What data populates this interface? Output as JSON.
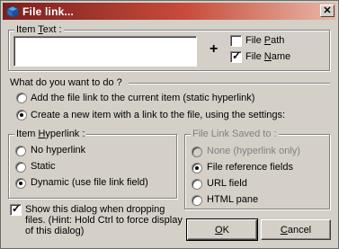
{
  "window": {
    "title": "File link..."
  },
  "item_text": {
    "legend": "Item Text :",
    "value": "",
    "file_path_label": "File Path",
    "file_path_checked": false,
    "file_name_label": "File Name",
    "file_name_checked": true
  },
  "action": {
    "header": "What do you want to do ?",
    "options": [
      {
        "label": "Add the file link to the current item (static hyperlink)",
        "selected": false
      },
      {
        "label": "Create a new item with a link to the file, using the settings:",
        "selected": true
      }
    ]
  },
  "item_hyperlink": {
    "legend": "Item Hyperlink :",
    "options": [
      {
        "label": "No hyperlink",
        "selected": false
      },
      {
        "label": "Static",
        "selected": false
      },
      {
        "label": "Dynamic (use file link field)",
        "selected": true
      }
    ]
  },
  "file_link_saved": {
    "legend": "File Link Saved to :",
    "options": [
      {
        "label": "None (hyperlink only)",
        "selected": false,
        "disabled": true
      },
      {
        "label": "File reference fields",
        "selected": true,
        "disabled": false
      },
      {
        "label": "URL field",
        "selected": false,
        "disabled": false
      },
      {
        "label": "HTML pane",
        "selected": false,
        "disabled": false
      }
    ]
  },
  "show_dialog": {
    "checked": true,
    "line1": "Show this dialog when dropping",
    "line2": "files. (Hint: Hold Ctrl to force display",
    "line3": "of this dialog)"
  },
  "buttons": {
    "ok": "OK",
    "cancel": "Cancel"
  },
  "colors": {
    "face": "#d4d0c8",
    "title_start": "#7a1f1f",
    "title_end": "#e8b8a8"
  }
}
